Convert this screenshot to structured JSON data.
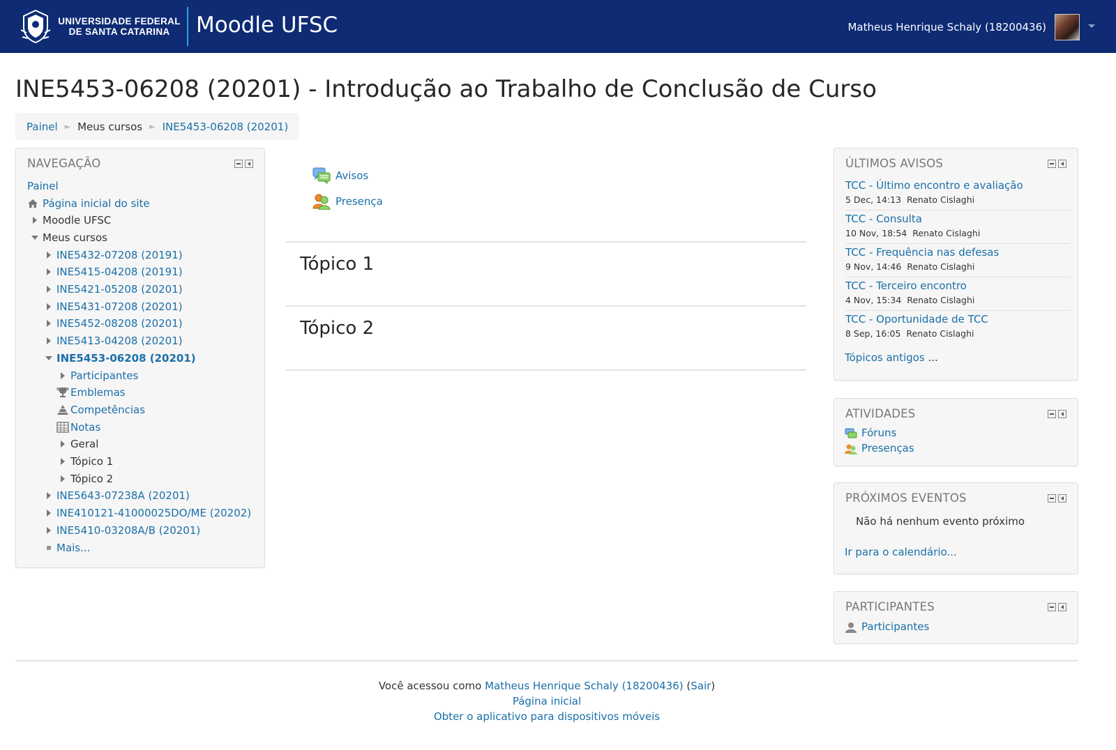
{
  "header": {
    "university_line1": "UNIVERSIDADE FEDERAL",
    "university_line2": "DE SANTA CATARINA",
    "site_name": "Moodle UFSC",
    "user_name": "Matheus Henrique Schaly (18200436)"
  },
  "page": {
    "title": "INE5453-06208 (20201) - Introdução ao Trabalho de Conclusão de Curso"
  },
  "breadcrumb": [
    "Painel",
    "Meus cursos",
    "INE5453-06208 (20201)"
  ],
  "navigation": {
    "title": "NAVEGAÇÃO",
    "items": [
      "Painel",
      "Página inicial do site",
      "Moodle UFSC",
      "Meus cursos",
      "INE5432-07208 (20191)",
      "INE5415-04208 (20191)",
      "INE5421-05208 (20201)",
      "INE5431-07208 (20201)",
      "INE5452-08208 (20201)",
      "INE5413-04208 (20201)",
      "INE5453-06208 (20201)",
      "Participantes",
      "Emblemas",
      "Competências",
      "Notas",
      "Geral",
      "Tópico 1",
      "Tópico 2",
      "INE5643-07238A (20201)",
      "INE410121-41000025DO/ME (20202)",
      "INE5410-03208A/B (20201)",
      "Mais..."
    ]
  },
  "main": {
    "activities": [
      "Avisos",
      "Presença"
    ],
    "sections": [
      "Tópico 1",
      "Tópico 2"
    ]
  },
  "latest_news": {
    "title": "ÚLTIMOS AVISOS",
    "items": [
      {
        "title": "TCC - Último encontro e avaliação",
        "date": "5 Dec, 14:13",
        "author": "Renato Cislaghi"
      },
      {
        "title": "TCC - Consulta",
        "date": "10 Nov, 18:54",
        "author": "Renato Cislaghi"
      },
      {
        "title": "TCC - Frequência nas defesas",
        "date": "9 Nov, 14:46",
        "author": "Renato Cislaghi"
      },
      {
        "title": "TCC - Terceiro encontro",
        "date": "4 Nov, 15:34",
        "author": "Renato Cislaghi"
      },
      {
        "title": "TCC - Oportunidade de TCC",
        "date": "8 Sep, 16:05",
        "author": "Renato Cislaghi"
      }
    ],
    "older_link": "Tópicos antigos",
    "older_suffix": " ..."
  },
  "activities_block": {
    "title": "ATIVIDADES",
    "items": [
      "Fóruns",
      "Presenças"
    ]
  },
  "upcoming": {
    "title": "PRÓXIMOS EVENTOS",
    "empty": "Não há nenhum evento próximo",
    "calendar_link": "Ir para o calendário..."
  },
  "participants_block": {
    "title": "PARTICIPANTES",
    "link": "Participantes"
  },
  "footer": {
    "logged_prefix": "Você acessou como ",
    "user_link": "Matheus Henrique Schaly (18200436)",
    "paren_open": " (",
    "logout": "Sair",
    "paren_close": ")",
    "home": "Página inicial",
    "app": "Obter o aplicativo para dispositivos móveis"
  },
  "colors": {
    "header_bg": "#0e2b74",
    "link": "#1a6fa8",
    "separator_accent": "#2fa3e0"
  }
}
